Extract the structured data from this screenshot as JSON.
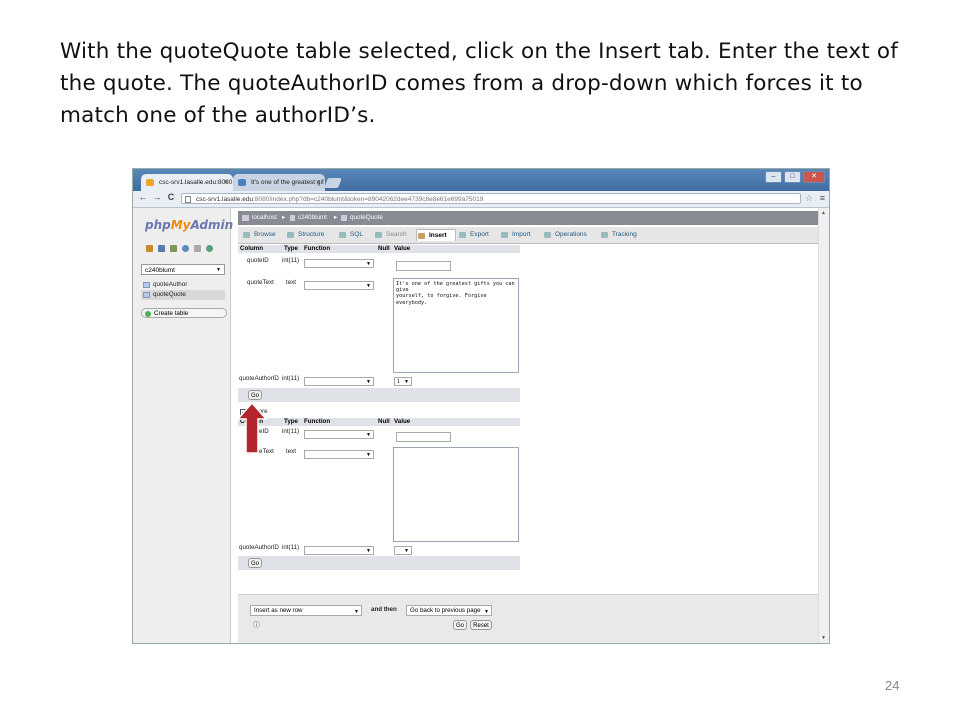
{
  "caption": "With the quoteQuote table selected, click on the Insert tab. Enter the text of the quote. The quoteAuthorID comes from a drop-down which forces it to match one of the authorID’s.",
  "slide_number": "24",
  "browser": {
    "tabs": [
      {
        "label": "csc-srv1.lasalle.edu:8080",
        "close": "×"
      },
      {
        "label": "It's one of the greatest gif",
        "close": "×"
      }
    ],
    "url_host": "csc-srv1.lasalle.edu",
    "url_path": ":8080/index.php?db=c240blumt&token=89042062dee4739c8e8e61e699a75019",
    "nav": {
      "back": "←",
      "forward": "→",
      "reload": "C"
    },
    "window_controls": {
      "min": "–",
      "max": "□",
      "close": "✕"
    },
    "star": "☆",
    "menu": "≡"
  },
  "sidebar": {
    "logo_php": "php",
    "logo_my": "My",
    "logo_admin": "Admin",
    "db_selected": "c240blumt",
    "tables": [
      "quoteAuthor",
      "quoteQuote"
    ],
    "create_table": "Create table"
  },
  "breadcrumbs": {
    "server": "localhost",
    "database": "c240blumt",
    "table": "quoteQuote"
  },
  "tabs": [
    "Browse",
    "Structure",
    "SQL",
    "Search",
    "Insert",
    "Export",
    "Import",
    "Operations",
    "Tracking"
  ],
  "form": {
    "headers": {
      "column": "Column",
      "type": "Type",
      "function": "Function",
      "null": "Null",
      "value": "Value"
    },
    "rows": [
      {
        "column": "quoteID",
        "type": "int(11)"
      },
      {
        "column": "quoteText",
        "type": "text"
      },
      {
        "column": "quoteAuthorID",
        "type": "int(11)"
      }
    ],
    "quote_text_value": "It's one of the greatest gifts you can give\nyourself, to forgive. Forgive everybody.",
    "author_id_value": "1",
    "go": "Go",
    "ignore": "Ignore"
  },
  "bottom": {
    "insert_mode": "Insert as new row",
    "and_then": "and then",
    "after_insert": "Go back to previous page",
    "go": "Go",
    "reset": "Reset"
  },
  "colors": {
    "arrow": "#b3262b",
    "arrow_border": "#ffffff"
  },
  "icons": [
    "home-icon",
    "table-icon",
    "dropdown-arrow-icon",
    "red-up-arrow-icon"
  ]
}
